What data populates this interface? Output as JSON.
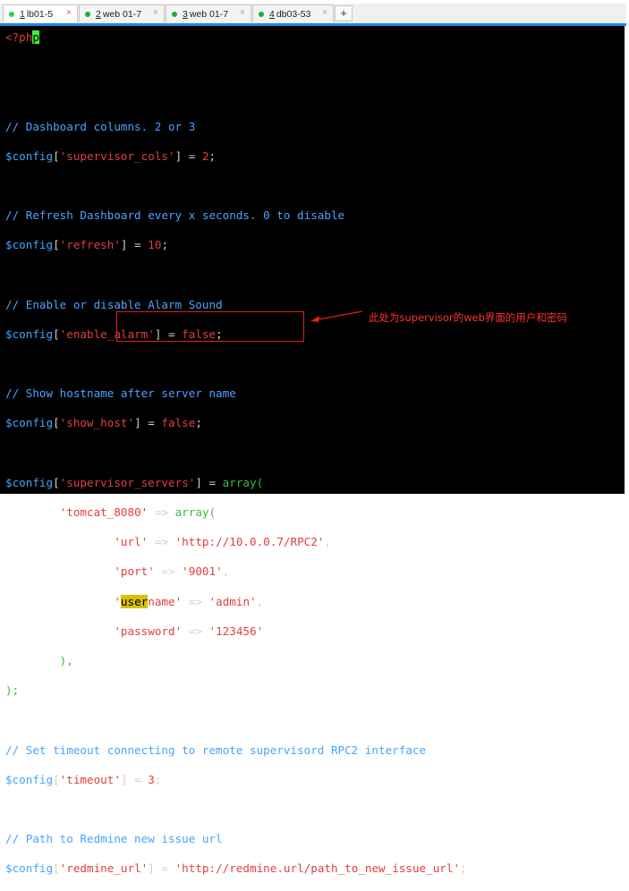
{
  "tabs": [
    {
      "num": "1",
      "label": "lb01-5",
      "dot": "#2bd14b",
      "active": true
    },
    {
      "num": "2",
      "label": "web 01-7",
      "dot": "#1fae3a",
      "active": false
    },
    {
      "num": "3",
      "label": "web 01-7",
      "dot": "#1fae3a",
      "active": false
    },
    {
      "num": "4",
      "label": "db03-53",
      "dot": "#1fae3a",
      "active": false
    }
  ],
  "tab_close": "×",
  "tab_add": "+",
  "code": {
    "php_open_a": "<?ph",
    "php_open_b": "p",
    "c1": "// Dashboard columns. 2 or 3",
    "c2": "// Refresh Dashboard every x seconds. 0 to disable",
    "c3": "// Enable or disable Alarm Sound",
    "c4": "// Show hostname after server name",
    "c5": "// Set timeout connecting to remote supervisord RPC2 interface",
    "c6": "// Path to Redmine new issue url",
    "config": "$config",
    "supervisor_cols": "'supervisor_cols'",
    "cols_val": "2",
    "refresh": "'refresh'",
    "refresh_val": "10",
    "enable_alarm": "'enable_alarm'",
    "false": "false",
    "show_host": "'show_host'",
    "supervisor_servers": "'supervisor_servers'",
    "array": "array",
    "tomcat": "'tomcat_8080'",
    "url_key": "'url'",
    "url_val": "'http://10.0.0.7/RPC2'",
    "port_key": "'port'",
    "port_val": "'9001'",
    "user_q": "'",
    "user_hl": "user",
    "user_rest": "name'",
    "user_val": "'admin'",
    "pass_key": "'password'",
    "pass_val": "'123456'",
    "timeout": "'timeout'",
    "timeout_val": "3",
    "redmine": "'redmine_url'",
    "redmine_val": "'http://redmine.url/path_to_new_issue_url'"
  },
  "annotation": "此处为supervisor的web界面的用户和密码"
}
